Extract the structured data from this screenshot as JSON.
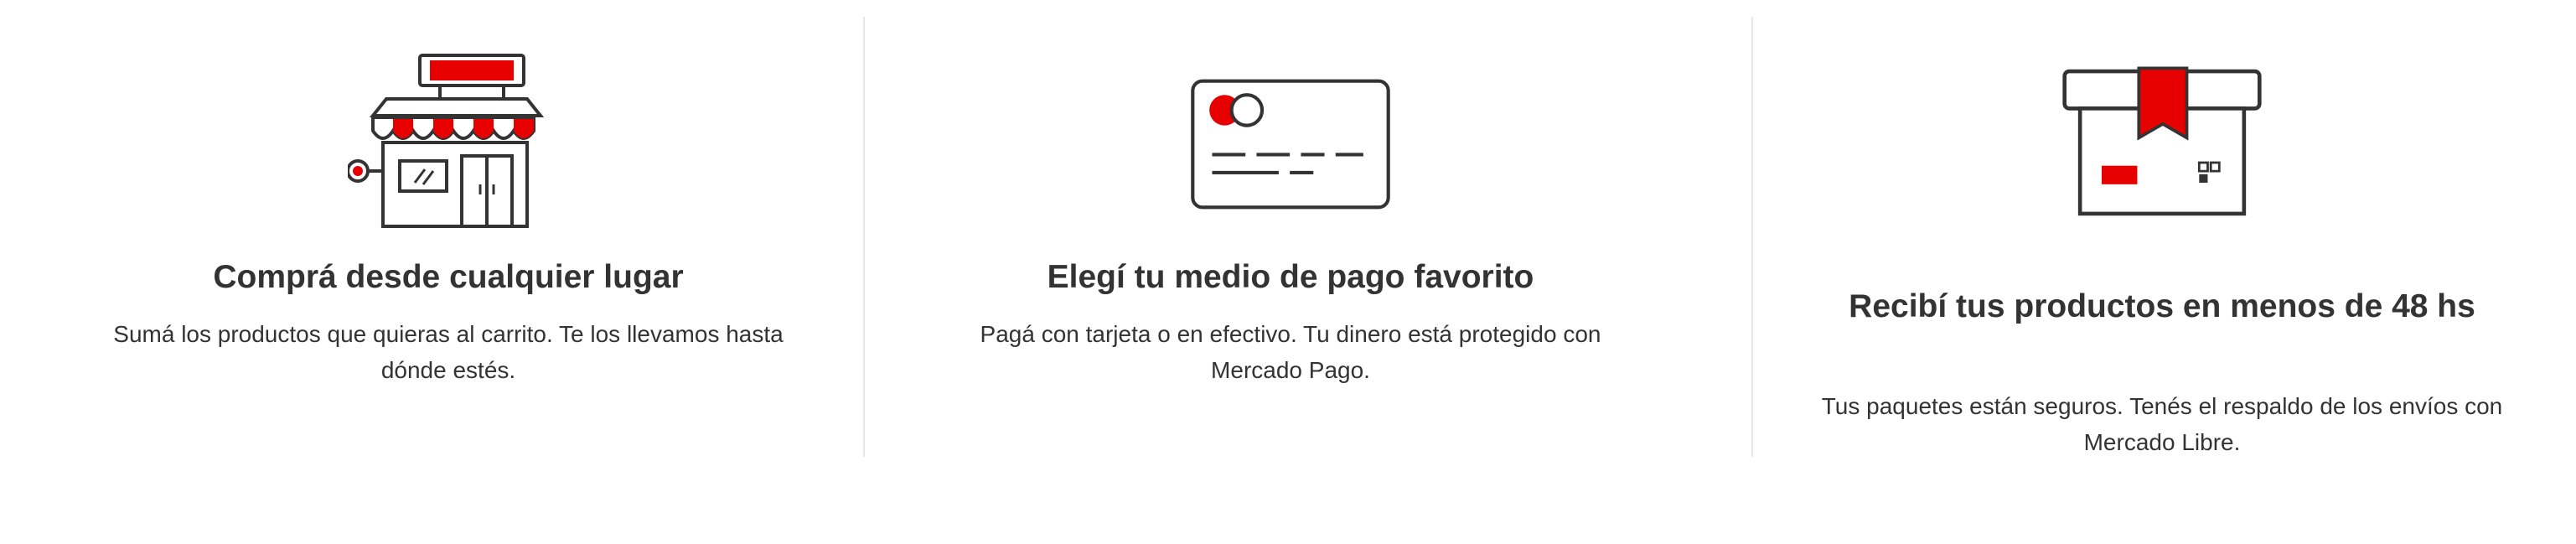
{
  "features": [
    {
      "icon": "store-icon",
      "title": "Comprá desde cualquier lugar",
      "description": "Sumá los productos que quieras al carrito. Te los llevamos hasta dónde estés."
    },
    {
      "icon": "credit-card-icon",
      "title": "Elegí tu medio de pago favorito",
      "description": "Pagá con tarjeta o en efectivo. Tu dinero está protegido con Mercado Pago."
    },
    {
      "icon": "package-icon",
      "title": "Recibí tus productos en menos de 48 hs",
      "description": "Tus paquetes están seguros. Tenés el respaldo de los envíos con Mercado Libre."
    }
  ],
  "colors": {
    "accent": "#e60000",
    "outline": "#333333",
    "divider": "#e6e6e6",
    "text": "#333333"
  }
}
